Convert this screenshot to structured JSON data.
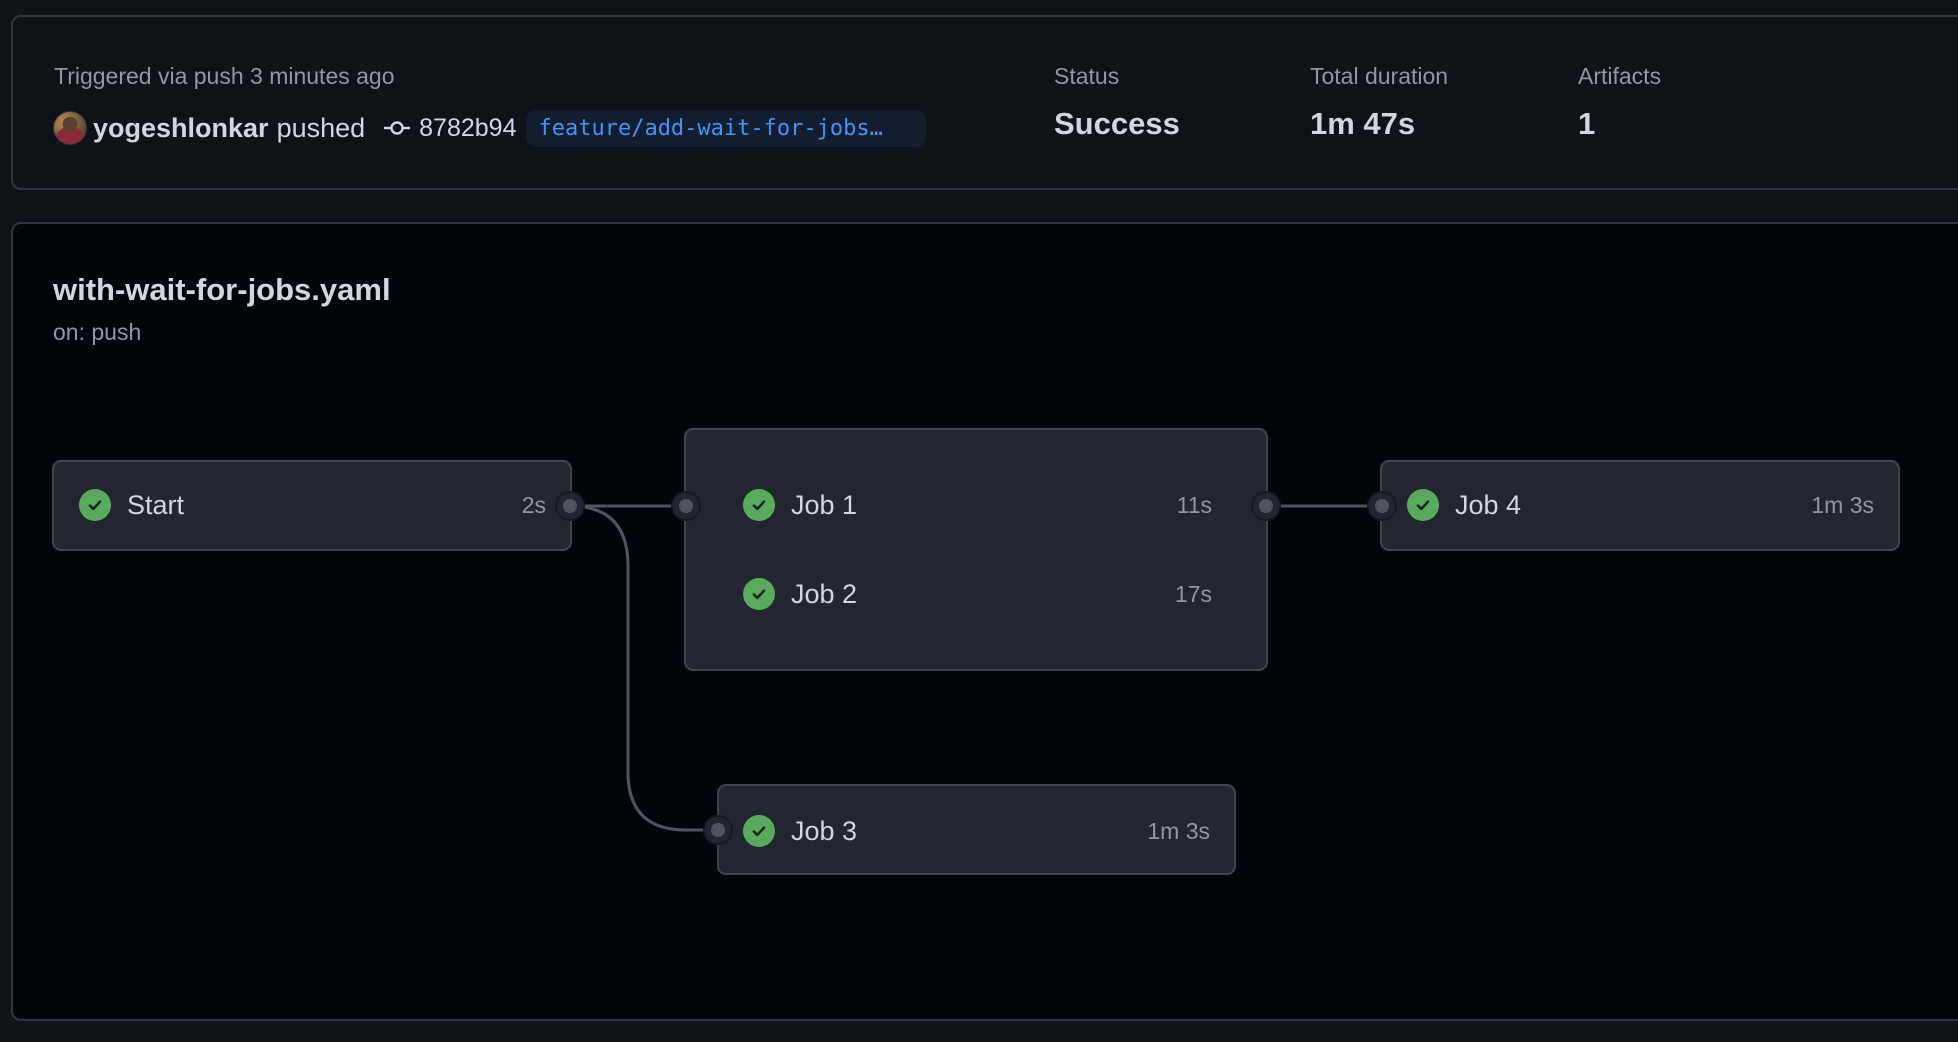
{
  "summary": {
    "trigger_text": "Triggered via push 3 minutes ago",
    "actor": {
      "avatar_icon": "user-avatar",
      "username": "yogeshlonkar",
      "action": "pushed"
    },
    "commit": {
      "icon": "git-commit-icon",
      "sha": "8782b94"
    },
    "branch": "feature/add-wait-for-jobs…",
    "stats": [
      {
        "label": "Status",
        "value": "Success"
      },
      {
        "label": "Total duration",
        "value": "1m 47s"
      },
      {
        "label": "Artifacts",
        "value": "1"
      }
    ]
  },
  "workflow": {
    "filename": "with-wait-for-jobs.yaml",
    "trigger": "on: push",
    "status_icon": "check-circle-icon",
    "colors": {
      "success": "#57ab5a",
      "edge": "#4d5561",
      "node_bg": "#212630",
      "branch_text": "#4493f8"
    },
    "nodes": [
      {
        "id": "start",
        "name": "Start",
        "duration": "2s",
        "status": "success"
      },
      {
        "id": "job1",
        "name": "Job 1",
        "duration": "11s",
        "status": "success",
        "group": "matrix"
      },
      {
        "id": "job2",
        "name": "Job 2",
        "duration": "17s",
        "status": "success",
        "group": "matrix"
      },
      {
        "id": "job3",
        "name": "Job 3",
        "duration": "1m 3s",
        "status": "success"
      },
      {
        "id": "job4",
        "name": "Job 4",
        "duration": "1m 3s",
        "status": "success"
      }
    ],
    "edges": [
      {
        "from": "start",
        "to": "job1-job2-group"
      },
      {
        "from": "start",
        "to": "job3"
      },
      {
        "from": "job1-job2-group",
        "to": "job4"
      }
    ]
  }
}
